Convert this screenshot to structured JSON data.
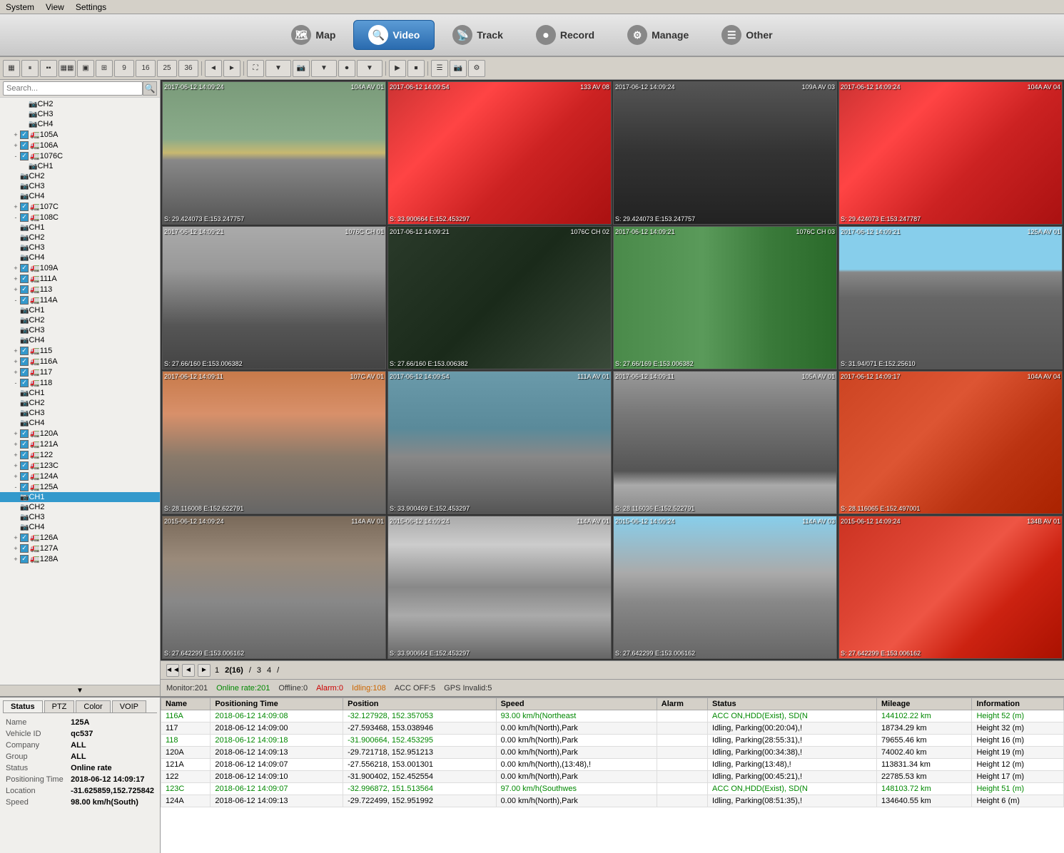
{
  "menubar": {
    "items": [
      "System",
      "View",
      "Settings"
    ]
  },
  "nav": {
    "tabs": [
      {
        "id": "map",
        "label": "Map",
        "icon": "🗺",
        "active": false
      },
      {
        "id": "video",
        "label": "Video",
        "icon": "🔍",
        "active": true
      },
      {
        "id": "track",
        "label": "Track",
        "icon": "📡",
        "active": false
      },
      {
        "id": "record",
        "label": "Record",
        "icon": "⏺",
        "active": false
      },
      {
        "id": "manage",
        "label": "Manage",
        "icon": "⚙",
        "active": false
      },
      {
        "id": "other",
        "label": "Other",
        "icon": "☰",
        "active": false
      }
    ]
  },
  "sidebar": {
    "search_placeholder": "Search...",
    "vehicles": [
      {
        "id": "CH2",
        "type": "cam",
        "indent": 2
      },
      {
        "id": "CH3",
        "type": "cam",
        "indent": 2
      },
      {
        "id": "CH4",
        "type": "cam",
        "indent": 2
      },
      {
        "id": "105A",
        "type": "truck",
        "indent": 1,
        "checked": true
      },
      {
        "id": "106A",
        "type": "truck",
        "indent": 1,
        "checked": true
      },
      {
        "id": "1076C",
        "type": "truck",
        "indent": 1,
        "checked": true
      },
      {
        "id": "CH1",
        "type": "cam",
        "indent": 2
      },
      {
        "id": "CH2",
        "type": "cam",
        "indent": 2
      },
      {
        "id": "CH3",
        "type": "cam",
        "indent": 2
      },
      {
        "id": "CH4",
        "type": "cam",
        "indent": 2
      },
      {
        "id": "107C",
        "type": "truck",
        "indent": 1,
        "checked": true
      },
      {
        "id": "108C",
        "type": "truck",
        "indent": 1,
        "checked": true
      },
      {
        "id": "CH1",
        "type": "cam",
        "indent": 2
      },
      {
        "id": "CH2",
        "type": "cam",
        "indent": 2
      },
      {
        "id": "CH3",
        "type": "cam",
        "indent": 2
      },
      {
        "id": "CH4",
        "type": "cam",
        "indent": 2
      },
      {
        "id": "109A",
        "type": "truck",
        "indent": 1,
        "checked": true
      },
      {
        "id": "111A",
        "type": "truck",
        "indent": 1,
        "checked": true
      },
      {
        "id": "113",
        "type": "truck",
        "indent": 1,
        "checked": true
      },
      {
        "id": "114A",
        "type": "truck",
        "indent": 1,
        "checked": true
      },
      {
        "id": "CH1",
        "type": "cam",
        "indent": 2
      },
      {
        "id": "CH2",
        "type": "cam",
        "indent": 2
      },
      {
        "id": "CH3",
        "type": "cam",
        "indent": 2
      },
      {
        "id": "CH4",
        "type": "cam",
        "indent": 2
      },
      {
        "id": "115",
        "type": "truck",
        "indent": 1,
        "checked": true
      },
      {
        "id": "116A",
        "type": "truck",
        "indent": 1,
        "checked": true
      },
      {
        "id": "117",
        "type": "truck",
        "indent": 1,
        "checked": true
      },
      {
        "id": "118",
        "type": "truck",
        "indent": 1,
        "checked": true
      },
      {
        "id": "CH1",
        "type": "cam",
        "indent": 2
      },
      {
        "id": "CH2",
        "type": "cam",
        "indent": 2
      },
      {
        "id": "CH3",
        "type": "cam",
        "indent": 2
      },
      {
        "id": "CH4",
        "type": "cam",
        "indent": 2
      },
      {
        "id": "120A",
        "type": "truck",
        "indent": 1,
        "checked": true
      },
      {
        "id": "121A",
        "type": "truck",
        "indent": 1,
        "checked": true
      },
      {
        "id": "122",
        "type": "truck",
        "indent": 1,
        "checked": true
      },
      {
        "id": "123C",
        "type": "truck",
        "indent": 1,
        "checked": true
      },
      {
        "id": "124A",
        "type": "truck",
        "indent": 1,
        "checked": true
      },
      {
        "id": "125A",
        "type": "truck",
        "indent": 1,
        "checked": true,
        "expanded": true
      },
      {
        "id": "CH1",
        "type": "cam",
        "indent": 2,
        "selected": true
      },
      {
        "id": "CH2",
        "type": "cam",
        "indent": 2
      },
      {
        "id": "CH3",
        "type": "cam",
        "indent": 2
      },
      {
        "id": "CH4",
        "type": "cam",
        "indent": 2
      },
      {
        "id": "126A",
        "type": "truck",
        "indent": 1,
        "checked": true
      },
      {
        "id": "127A",
        "type": "truck",
        "indent": 1,
        "checked": true
      },
      {
        "id": "128A",
        "type": "truck",
        "indent": 1,
        "checked": true
      }
    ]
  },
  "video_grid": {
    "cells": [
      {
        "id": 1,
        "timestamp": "2017-06-12 14:09:24",
        "label": "104A AV 01",
        "coords": "S: 29.424073 E:153.247757",
        "style": "cam-road"
      },
      {
        "id": 2,
        "timestamp": "2017-06-12 14:09:54",
        "label": "133 AV 08",
        "coords": "S: 33.900664 E:152.453297",
        "style": "cam-truck-red"
      },
      {
        "id": 3,
        "timestamp": "2017-06-12 14:09:24",
        "label": "109A AV 03",
        "coords": "S: 29.424073 E:153.247757",
        "style": "cam-dark"
      },
      {
        "id": 4,
        "timestamp": "2017-06-12 14:09:24",
        "label": "104A AV 04",
        "coords": "S: 29.424073 E:153.247787",
        "style": "cam-truck-red"
      },
      {
        "id": 5,
        "timestamp": "2017-06-12 14:09:21",
        "label": "1076C CH 01",
        "coords": "S: 27.66/160 E:153.006382",
        "style": "cam-parking"
      },
      {
        "id": 6,
        "timestamp": "2017-06-12 14:09:21",
        "label": "1076C CH 02",
        "coords": "S: 27.66/160 E:153.006382",
        "style": "cam-dark"
      },
      {
        "id": 7,
        "timestamp": "2017-06-12 14:09:21",
        "label": "1076C CH 03",
        "coords": "S: 27.66/169 E:153.006382",
        "style": "cam-green-truck"
      },
      {
        "id": 8,
        "timestamp": "2017-06-12 14:09:21",
        "label": "125A AV 01",
        "coords": "S: 31.94/071 E:152.25610",
        "style": "cam-highway"
      },
      {
        "id": 9,
        "timestamp": "2017-06-12 14:09:11",
        "label": "107C AV 01",
        "coords": "S: 28.116008 E:152.622791",
        "style": "cam-construction"
      },
      {
        "id": 10,
        "timestamp": "2017-06-12 14:09:54",
        "label": "111A AV 01",
        "coords": "S: 33.900469 E:152.453297",
        "style": "cam-blue-car"
      },
      {
        "id": 11,
        "timestamp": "2017-06-12 14:09:11",
        "label": "105A AV 01",
        "coords": "S: 28.116036 E:152.522791",
        "style": "cam-road2"
      },
      {
        "id": 12,
        "timestamp": "2017-06-12 14:09:17",
        "label": "104A AV 04",
        "coords": "S: 28.116065 E:152.497001",
        "style": "cam-red-truck2"
      },
      {
        "id": 13,
        "timestamp": "2015-06-12 14:09:24",
        "label": "114A AV 01",
        "coords": "S: 27.642299 E:153.006162",
        "style": "cam-road"
      },
      {
        "id": 14,
        "timestamp": "2015-06-12 14:09:24",
        "label": "114A AV 01",
        "coords": "S: 33.900664 E:152.453297",
        "style": "cam-blue-car"
      },
      {
        "id": 15,
        "timestamp": "2015-06-12 14:09:24",
        "label": "114A AV 03",
        "coords": "S: 27.642299 E:153.006162",
        "style": "cam-overpass"
      },
      {
        "id": 16,
        "timestamp": "2015-06-12 14:09:24",
        "label": "134B AV 01",
        "coords": "S: 27.642299 E:153.006162",
        "style": "cam-truck-red"
      }
    ]
  },
  "pagination": {
    "prev_btn": "◄",
    "first_btn": "◄◄",
    "pages": [
      "1",
      "2(16)",
      "3",
      "4"
    ],
    "current_page": "2(16)",
    "next_btn": "►",
    "slash": "/"
  },
  "status_bar": {
    "monitor": "Monitor:201",
    "online": "Online rate:201",
    "offline": "Offline:0",
    "alarm": "Alarm:0",
    "idling": "Idling:108",
    "acc_off": "ACC OFF:5",
    "gps_invalid": "GPS Invalid:5"
  },
  "info_tabs": [
    "Status",
    "PTZ",
    "Color",
    "VOIP"
  ],
  "info_data": {
    "name": {
      "label": "Name",
      "value": "125A"
    },
    "vehicle_id": {
      "label": "Vehicle ID",
      "value": "qc537"
    },
    "company": {
      "label": "Company",
      "value": "ALL"
    },
    "group": {
      "label": "Group",
      "value": "ALL"
    },
    "status": {
      "label": "Status",
      "value": "Online rate"
    },
    "positioning_time": {
      "label": "Positioning Time",
      "value": "2018-06-12 14:09:17"
    },
    "location": {
      "label": "Location",
      "value": "-31.625859,152.725842"
    },
    "speed": {
      "label": "Speed",
      "value": "98.00 km/h(South)"
    }
  },
  "table": {
    "headers": [
      "Name",
      "Positioning Time",
      "Position",
      "Speed",
      "Alarm",
      "Status",
      "Mileage",
      "Information"
    ],
    "rows": [
      {
        "name": "116A",
        "name_color": "green",
        "positioning_time": "2018-06-12 14:09:08",
        "time_color": "green",
        "position": "-32.127928, 152.357053",
        "pos_color": "green",
        "speed": "93.00 km/h(Northeast",
        "speed_color": "green",
        "alarm": "",
        "alarm_color": "black",
        "status": "ACC ON,HDD(Exist), SD(N",
        "status_color": "green",
        "mileage": "144102.22 km",
        "mileage_color": "green",
        "information": "Height 52 (m)",
        "info_color": "green"
      },
      {
        "name": "117",
        "name_color": "black",
        "positioning_time": "2018-06-12 14:09:00",
        "time_color": "black",
        "position": "-27.593468, 153.038946",
        "pos_color": "black",
        "speed": "0.00 km/h(North),Park",
        "speed_color": "black",
        "alarm": "",
        "alarm_color": "black",
        "status": "Idling, Parking(00:20:04),!",
        "status_color": "black",
        "mileage": "18734.29 km",
        "mileage_color": "black",
        "information": "Height 32 (m)",
        "info_color": "black"
      },
      {
        "name": "118",
        "name_color": "green",
        "positioning_time": "2018-06-12 14:09:18",
        "time_color": "green",
        "position": "-31.900664, 152.453295",
        "pos_color": "green",
        "speed": "0.00 km/h(North),Park",
        "speed_color": "black",
        "alarm": "",
        "alarm_color": "black",
        "status": "Idling, Parking(28:55:31),!",
        "status_color": "black",
        "mileage": "79655.46 km",
        "mileage_color": "black",
        "information": "Height 16 (m)",
        "info_color": "black"
      },
      {
        "name": "120A",
        "name_color": "black",
        "positioning_time": "2018-06-12 14:09:13",
        "time_color": "black",
        "position": "-29.721718, 152.951213",
        "pos_color": "black",
        "speed": "0.00 km/h(North),Park",
        "speed_color": "black",
        "alarm": "",
        "alarm_color": "black",
        "status": "Idling, Parking(00:34:38),!",
        "status_color": "black",
        "mileage": "74002.40 km",
        "mileage_color": "black",
        "information": "Height 19 (m)",
        "info_color": "black"
      },
      {
        "name": "121A",
        "name_color": "black",
        "positioning_time": "2018-06-12 14:09:07",
        "time_color": "black",
        "position": "-27.556218, 153.001301",
        "pos_color": "black",
        "speed": "0.00 km/h(North),(13:48),!",
        "speed_color": "black",
        "alarm": "",
        "alarm_color": "black",
        "status": "Idling, Parking(13:48),!",
        "status_color": "black",
        "mileage": "113831.34 km",
        "mileage_color": "black",
        "information": "Height 12 (m)",
        "info_color": "black"
      },
      {
        "name": "122",
        "name_color": "black",
        "positioning_time": "2018-06-12 14:09:10",
        "time_color": "black",
        "position": "-31.900402, 152.452554",
        "pos_color": "black",
        "speed": "0.00 km/h(North),Park",
        "speed_color": "black",
        "alarm": "",
        "alarm_color": "black",
        "status": "Idling, Parking(00:45:21),!",
        "status_color": "black",
        "mileage": "22785.53 km",
        "mileage_color": "black",
        "information": "Height 17 (m)",
        "info_color": "black"
      },
      {
        "name": "123C",
        "name_color": "green",
        "positioning_time": "2018-06-12 14:09:07",
        "time_color": "green",
        "position": "-32.996872, 151.513564",
        "pos_color": "green",
        "speed": "97.00 km/h(Southwes",
        "speed_color": "green",
        "alarm": "",
        "alarm_color": "black",
        "status": "ACC ON,HDD(Exist), SD(N",
        "status_color": "green",
        "mileage": "148103.72 km",
        "mileage_color": "green",
        "information": "Height 51 (m)",
        "info_color": "green"
      },
      {
        "name": "124A",
        "name_color": "black",
        "positioning_time": "2018-06-12 14:09:13",
        "time_color": "black",
        "position": "-29.722499, 152.951992",
        "pos_color": "black",
        "speed": "0.00 km/h(North),Park",
        "speed_color": "black",
        "alarm": "",
        "alarm_color": "black",
        "status": "Idling, Parking(08:51:35),!",
        "status_color": "black",
        "mileage": "134640.55 km",
        "mileage_color": "black",
        "information": "Height 6 (m)",
        "info_color": "black"
      }
    ]
  }
}
